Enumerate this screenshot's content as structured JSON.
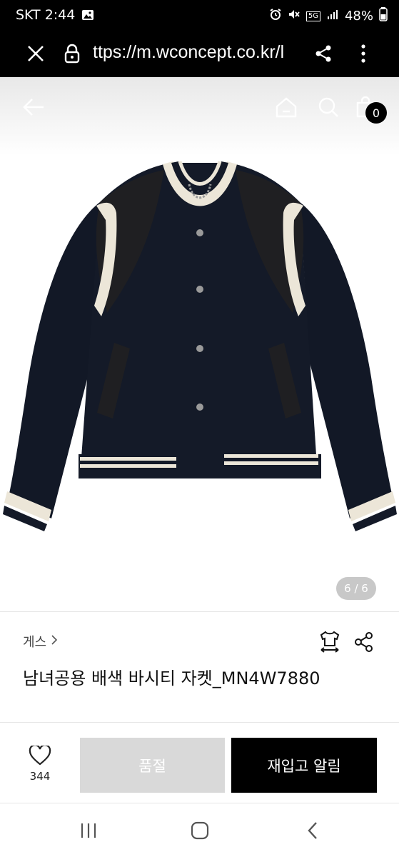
{
  "status_bar": {
    "carrier_time": "SKT 2:44",
    "network": "5G",
    "battery": "48%"
  },
  "browser": {
    "url": "ttps://m.wconcept.co.kr/l"
  },
  "header": {
    "cart_count": "0"
  },
  "gallery": {
    "page_indicator": "6 / 6"
  },
  "product": {
    "brand": "게스",
    "name": "남녀공용 배색 바시티 자켓_MN4W7880",
    "like_count": "344"
  },
  "actions": {
    "soldout_label": "품절",
    "restock_label": "재입고 알림"
  },
  "colors": {
    "black": "#000000",
    "soldout_gray": "#d9d9d9",
    "jacket_navy": "#121826",
    "stripe_cream": "#ece6d8"
  }
}
